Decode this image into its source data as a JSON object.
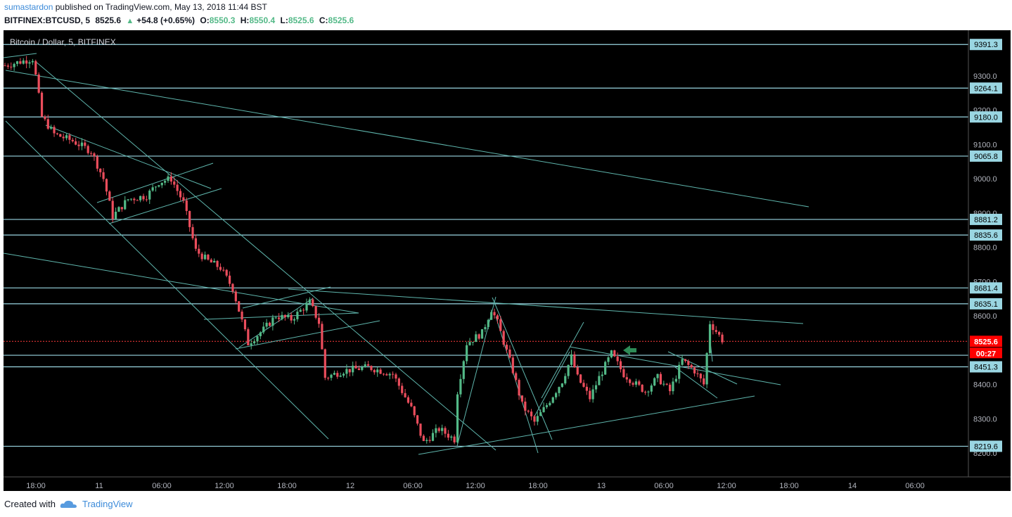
{
  "header": {
    "author": "sumastardon",
    "published_text": "published on TradingView.com, May 13, 2018 11:44 BST",
    "symbol": "BITFINEX:BTCUSD, 5",
    "last": "8525.6",
    "change_arrow": "▲",
    "change": "+54.8 (+0.65%)",
    "o_label": "O:",
    "o_value": "8550.3",
    "h_label": "H:",
    "h_value": "8550.4",
    "l_label": "L:",
    "l_value": "8525.6",
    "c_label": "C:",
    "c_value": "8525.6"
  },
  "footer": {
    "created_with": "Created with",
    "brand": "TradingView",
    "logo_icon": "cloud-logo-icon"
  },
  "colors": {
    "background": "#000000",
    "up_candle": "#53b987",
    "down_candle": "#eb4d5c",
    "trendline": "#5fb6ad",
    "level_line": "#9ad6e2",
    "price_label_bg": "#9ad6e2",
    "current_price_bg": "#ff0000",
    "arrow": "#2e8b57"
  },
  "chart_data": {
    "type": "candlestick",
    "title": "Bitcoin / Dollar, 5, BITFINEX",
    "ylim": [
      8160,
      9420
    ],
    "y_ticks": [
      "8200.0",
      "8300.0",
      "8400.0",
      "8500.0",
      "8600.0",
      "8700.0",
      "8800.0",
      "8900.0",
      "9000.0",
      "9100.0",
      "9200.0",
      "9300.0"
    ],
    "x_ticks": [
      "18:00",
      "11",
      "06:00",
      "12:00",
      "18:00",
      "12",
      "06:00",
      "12:00",
      "18:00",
      "13",
      "06:00",
      "12:00",
      "18:00",
      "14",
      "06:00"
    ],
    "current_price": "8525.6",
    "countdown": "00:27",
    "horizontal_levels": [
      "9391.3",
      "9264.1",
      "9180.0",
      "9065.8",
      "8881.2",
      "8835.6",
      "8681.4",
      "8635.1",
      "8451.3",
      "8219.6"
    ],
    "unlabeled_level": 8485,
    "price_path_keypoints": [
      [
        0,
        9330
      ],
      [
        9,
        9350
      ],
      [
        10,
        9300
      ],
      [
        12,
        9180
      ],
      [
        16,
        9130
      ],
      [
        22,
        9110
      ],
      [
        28,
        9080
      ],
      [
        32,
        9000
      ],
      [
        35,
        8890
      ],
      [
        40,
        8940
      ],
      [
        46,
        8950
      ],
      [
        50,
        8990
      ],
      [
        54,
        9000
      ],
      [
        58,
        8930
      ],
      [
        62,
        8790
      ],
      [
        66,
        8760
      ],
      [
        70,
        8740
      ],
      [
        74,
        8680
      ],
      [
        79,
        8520
      ],
      [
        84,
        8560
      ],
      [
        88,
        8600
      ],
      [
        93,
        8590
      ],
      [
        99,
        8640
      ],
      [
        102,
        8580
      ],
      [
        104,
        8420
      ],
      [
        110,
        8440
      ],
      [
        118,
        8450
      ],
      [
        126,
        8430
      ],
      [
        132,
        8330
      ],
      [
        136,
        8230
      ],
      [
        141,
        8270
      ],
      [
        146,
        8240
      ],
      [
        147,
        8380
      ],
      [
        150,
        8520
      ],
      [
        155,
        8550
      ],
      [
        158,
        8620
      ],
      [
        160,
        8580
      ],
      [
        165,
        8440
      ],
      [
        168,
        8340
      ],
      [
        172,
        8290
      ],
      [
        176,
        8340
      ],
      [
        181,
        8410
      ],
      [
        184,
        8480
      ],
      [
        186,
        8420
      ],
      [
        190,
        8360
      ],
      [
        193,
        8420
      ],
      [
        197,
        8490
      ],
      [
        201,
        8430
      ],
      [
        205,
        8400
      ],
      [
        208,
        8380
      ],
      [
        212,
        8420
      ],
      [
        216,
        8380
      ],
      [
        220,
        8470
      ],
      [
        224,
        8440
      ],
      [
        227,
        8400
      ],
      [
        229,
        8580
      ],
      [
        233,
        8530
      ]
    ]
  }
}
